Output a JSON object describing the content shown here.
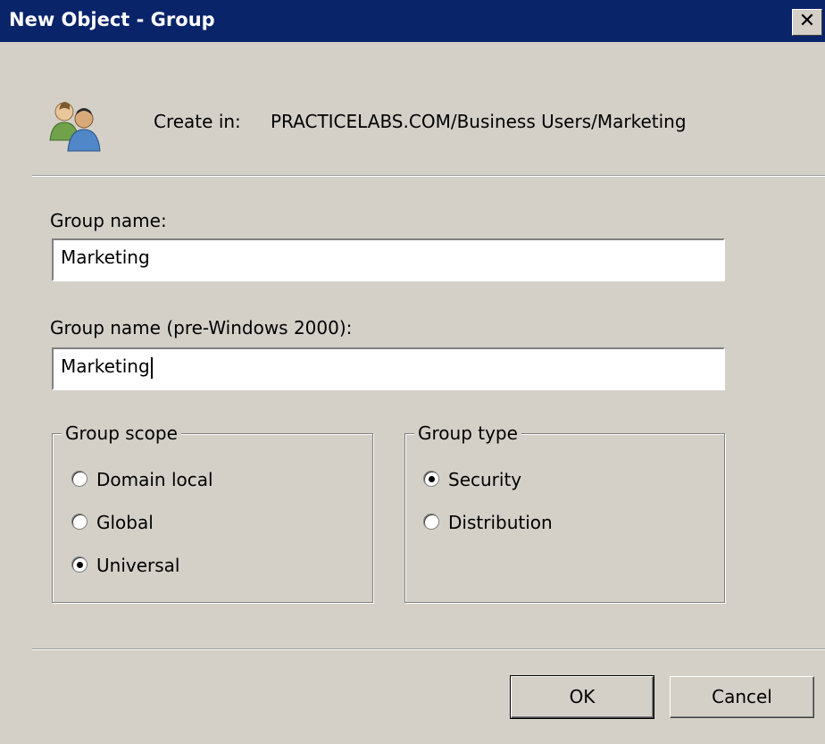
{
  "window": {
    "title": "New Object - Group",
    "close_glyph": "✕"
  },
  "header": {
    "icon": "group-users-icon",
    "create_in_label": "Create in:",
    "create_in_path": "PRACTICELABS.COM/Business Users/Marketing"
  },
  "form": {
    "group_name_label": "Group name:",
    "group_name_value": "Marketing",
    "pre2000_label": "Group name (pre-Windows 2000):",
    "pre2000_value": "Marketing"
  },
  "group_scope": {
    "legend": "Group scope",
    "options": [
      {
        "label": "Domain local",
        "selected": false
      },
      {
        "label": "Global",
        "selected": false
      },
      {
        "label": "Universal",
        "selected": true
      }
    ]
  },
  "group_type": {
    "legend": "Group type",
    "options": [
      {
        "label": "Security",
        "selected": true
      },
      {
        "label": "Distribution",
        "selected": false
      }
    ]
  },
  "buttons": {
    "ok": "OK",
    "cancel": "Cancel"
  },
  "colors": {
    "titlebar": "#0a246a",
    "dialog_bg": "#d4d0c8"
  }
}
